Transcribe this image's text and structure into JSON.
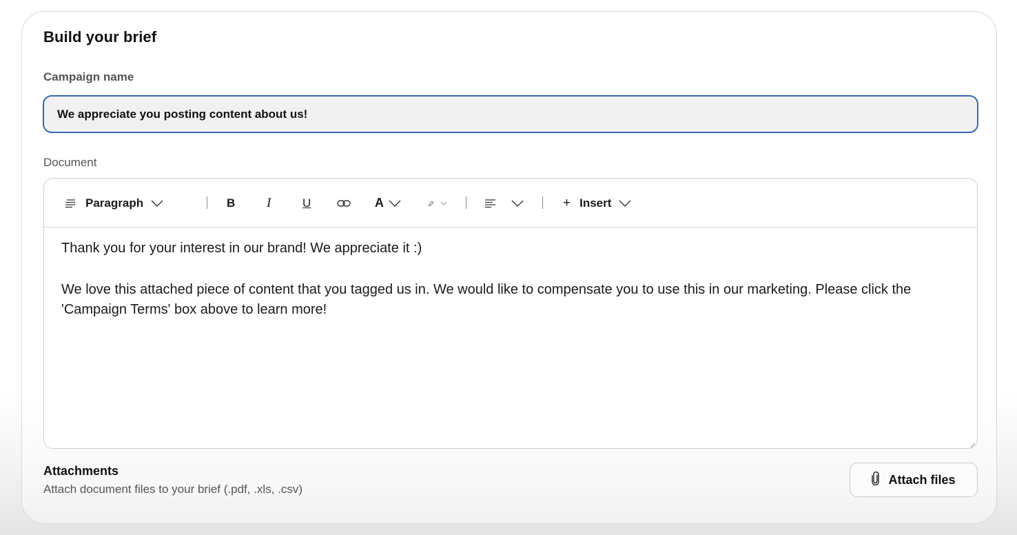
{
  "card": {
    "title": "Build your brief"
  },
  "campaign": {
    "label": "Campaign name",
    "value": "We appreciate you posting content about us!"
  },
  "document": {
    "label": "Document",
    "toolbar": {
      "paragraph_label": "Paragraph",
      "bold_label": "B",
      "italic_label": "I",
      "underline_label": "U",
      "font_color_label": "A",
      "insert_plus": "+",
      "insert_label": "Insert",
      "icons": {
        "paragraph": "paragraph-lines-icon",
        "link": "link-icon",
        "highlight": "highlight-pen-icon",
        "align": "align-left-icon",
        "chevron": "chevron-down-icon"
      }
    },
    "content": {
      "line1": "Thank you for your interest in our brand! We appreciate it :)",
      "line2": "We love this attached piece of content that you tagged us in. We would like to compensate you to use this in our marketing. Please click the 'Campaign Terms' box above to learn more!"
    }
  },
  "attachments": {
    "title": "Attachments",
    "subtitle": "Attach document files to your brief (.pdf, .xls, .csv)",
    "button_label": "Attach files",
    "button_icon": "paperclip-icon"
  },
  "colors": {
    "input_border": "#3569b5",
    "input_bg": "#f1f1f1",
    "card_border": "#d8d8d8"
  }
}
